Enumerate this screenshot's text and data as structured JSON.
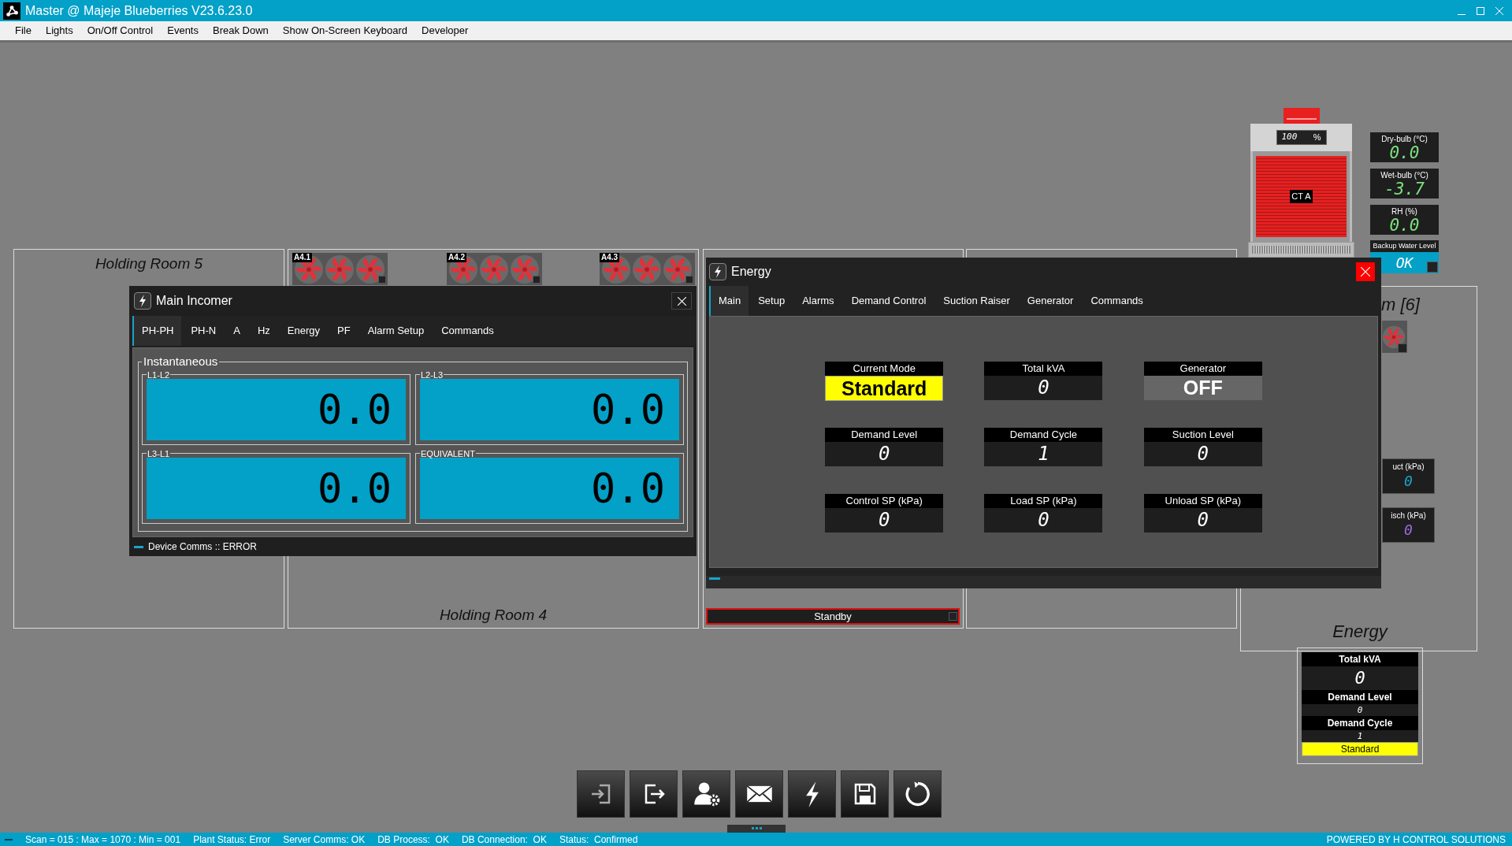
{
  "window": {
    "title": "Master @ Majeje Blueberries V23.6.23.0"
  },
  "menu": [
    "File",
    "Lights",
    "On/Off Control",
    "Events",
    "Break Down",
    "Show On-Screen Keyboard",
    "Developer"
  ],
  "rooms": [
    {
      "title": "Holding Room 5"
    },
    {
      "title": "Holding Room 4"
    }
  ],
  "fan_units": [
    {
      "label": "A4.1"
    },
    {
      "label": "A4.2"
    },
    {
      "label": "A4.3"
    }
  ],
  "cooling_tower": {
    "label": "CT A",
    "speed": "100",
    "unit": "%"
  },
  "weather": [
    {
      "label": "Dry-bulb (°C)",
      "value": "0.0",
      "color": "#7ee07e"
    },
    {
      "label": "Wet-bulb (°C)",
      "value": "-3.7",
      "color": "#7ee07e"
    },
    {
      "label": "RH (%)",
      "value": "0.0",
      "color": "#7ee07e"
    }
  ],
  "backup_water": {
    "label": "Backup Water Level",
    "value": "OK"
  },
  "room6": {
    "title": "m [6]",
    "pressures": [
      {
        "label": "uct (kPa)",
        "value": "0",
        "color": "#1aa3c8"
      },
      {
        "label": "isch (kPa)",
        "value": "0",
        "color": "#9a6ae0"
      }
    ]
  },
  "main_incomer": {
    "title": "Main Incomer",
    "tabs": [
      {
        "label": "PH-PH",
        "selected": true
      },
      {
        "label": "PH-N",
        "selected": false
      },
      {
        "label": "A",
        "selected": false
      },
      {
        "label": "Hz",
        "selected": false
      },
      {
        "label": "Energy",
        "selected": false
      },
      {
        "label": "PF",
        "selected": false
      },
      {
        "label": "Alarm Setup",
        "selected": false
      },
      {
        "label": "Commands",
        "selected": false
      }
    ],
    "group": "Instantaneous",
    "displays": [
      {
        "label": "L1-L2",
        "value": "0.0"
      },
      {
        "label": "L2-L3",
        "value": "0.0"
      },
      {
        "label": "L3-L1",
        "value": "0.0"
      },
      {
        "label": "EQUIVALENT",
        "value": "0.0"
      }
    ],
    "footer": "Device Comms :: ERROR"
  },
  "energy_window": {
    "title": "Energy",
    "tabs": [
      {
        "label": "Main",
        "selected": true
      },
      {
        "label": "Setup",
        "selected": false
      },
      {
        "label": "Alarms",
        "selected": false
      },
      {
        "label": "Demand Control",
        "selected": false
      },
      {
        "label": "Suction Raiser",
        "selected": false
      },
      {
        "label": "Generator",
        "selected": false
      },
      {
        "label": "Commands",
        "selected": false
      }
    ],
    "tiles": [
      {
        "label": "Current Mode",
        "value": "Standard",
        "kind": "mode"
      },
      {
        "label": "Total kVA",
        "value": "0",
        "kind": "number"
      },
      {
        "label": "Generator",
        "value": "OFF",
        "kind": "state"
      },
      {
        "label": "Demand Level",
        "value": "0",
        "kind": "number"
      },
      {
        "label": "Demand Cycle",
        "value": "1",
        "kind": "number"
      },
      {
        "label": "Suction Level",
        "value": "0",
        "kind": "number"
      },
      {
        "label": "Control SP (kPa)",
        "value": "0",
        "kind": "number"
      },
      {
        "label": "Load SP (kPa)",
        "value": "0",
        "kind": "number"
      },
      {
        "label": "Unload SP (kPa)",
        "value": "0",
        "kind": "number"
      }
    ]
  },
  "standby": {
    "label": "Standby"
  },
  "energy_summary": {
    "title": "Energy",
    "rows": [
      {
        "label": "Total kVA",
        "value": "0",
        "kind": "large"
      },
      {
        "label": "Demand Level",
        "value": "0",
        "kind": "small"
      },
      {
        "label": "Demand Cycle",
        "value": "1",
        "kind": "small"
      }
    ],
    "mode": "Standard"
  },
  "toolbar": [
    {
      "kind": "login"
    },
    {
      "kind": "logout"
    },
    {
      "kind": "user-settings"
    },
    {
      "kind": "mail"
    },
    {
      "kind": "energy"
    },
    {
      "kind": "save"
    },
    {
      "kind": "refresh"
    }
  ],
  "status_bar": {
    "items": [
      "Scan = 015 : Max = 1070 : Min = 001",
      "Plant Status: Error",
      "Server Comms: OK",
      "DB Process:  OK",
      "DB Connection:  OK",
      "Status:  Confirmed"
    ],
    "credit": "POWERED BY H CONTROL SOLUTIONS"
  }
}
